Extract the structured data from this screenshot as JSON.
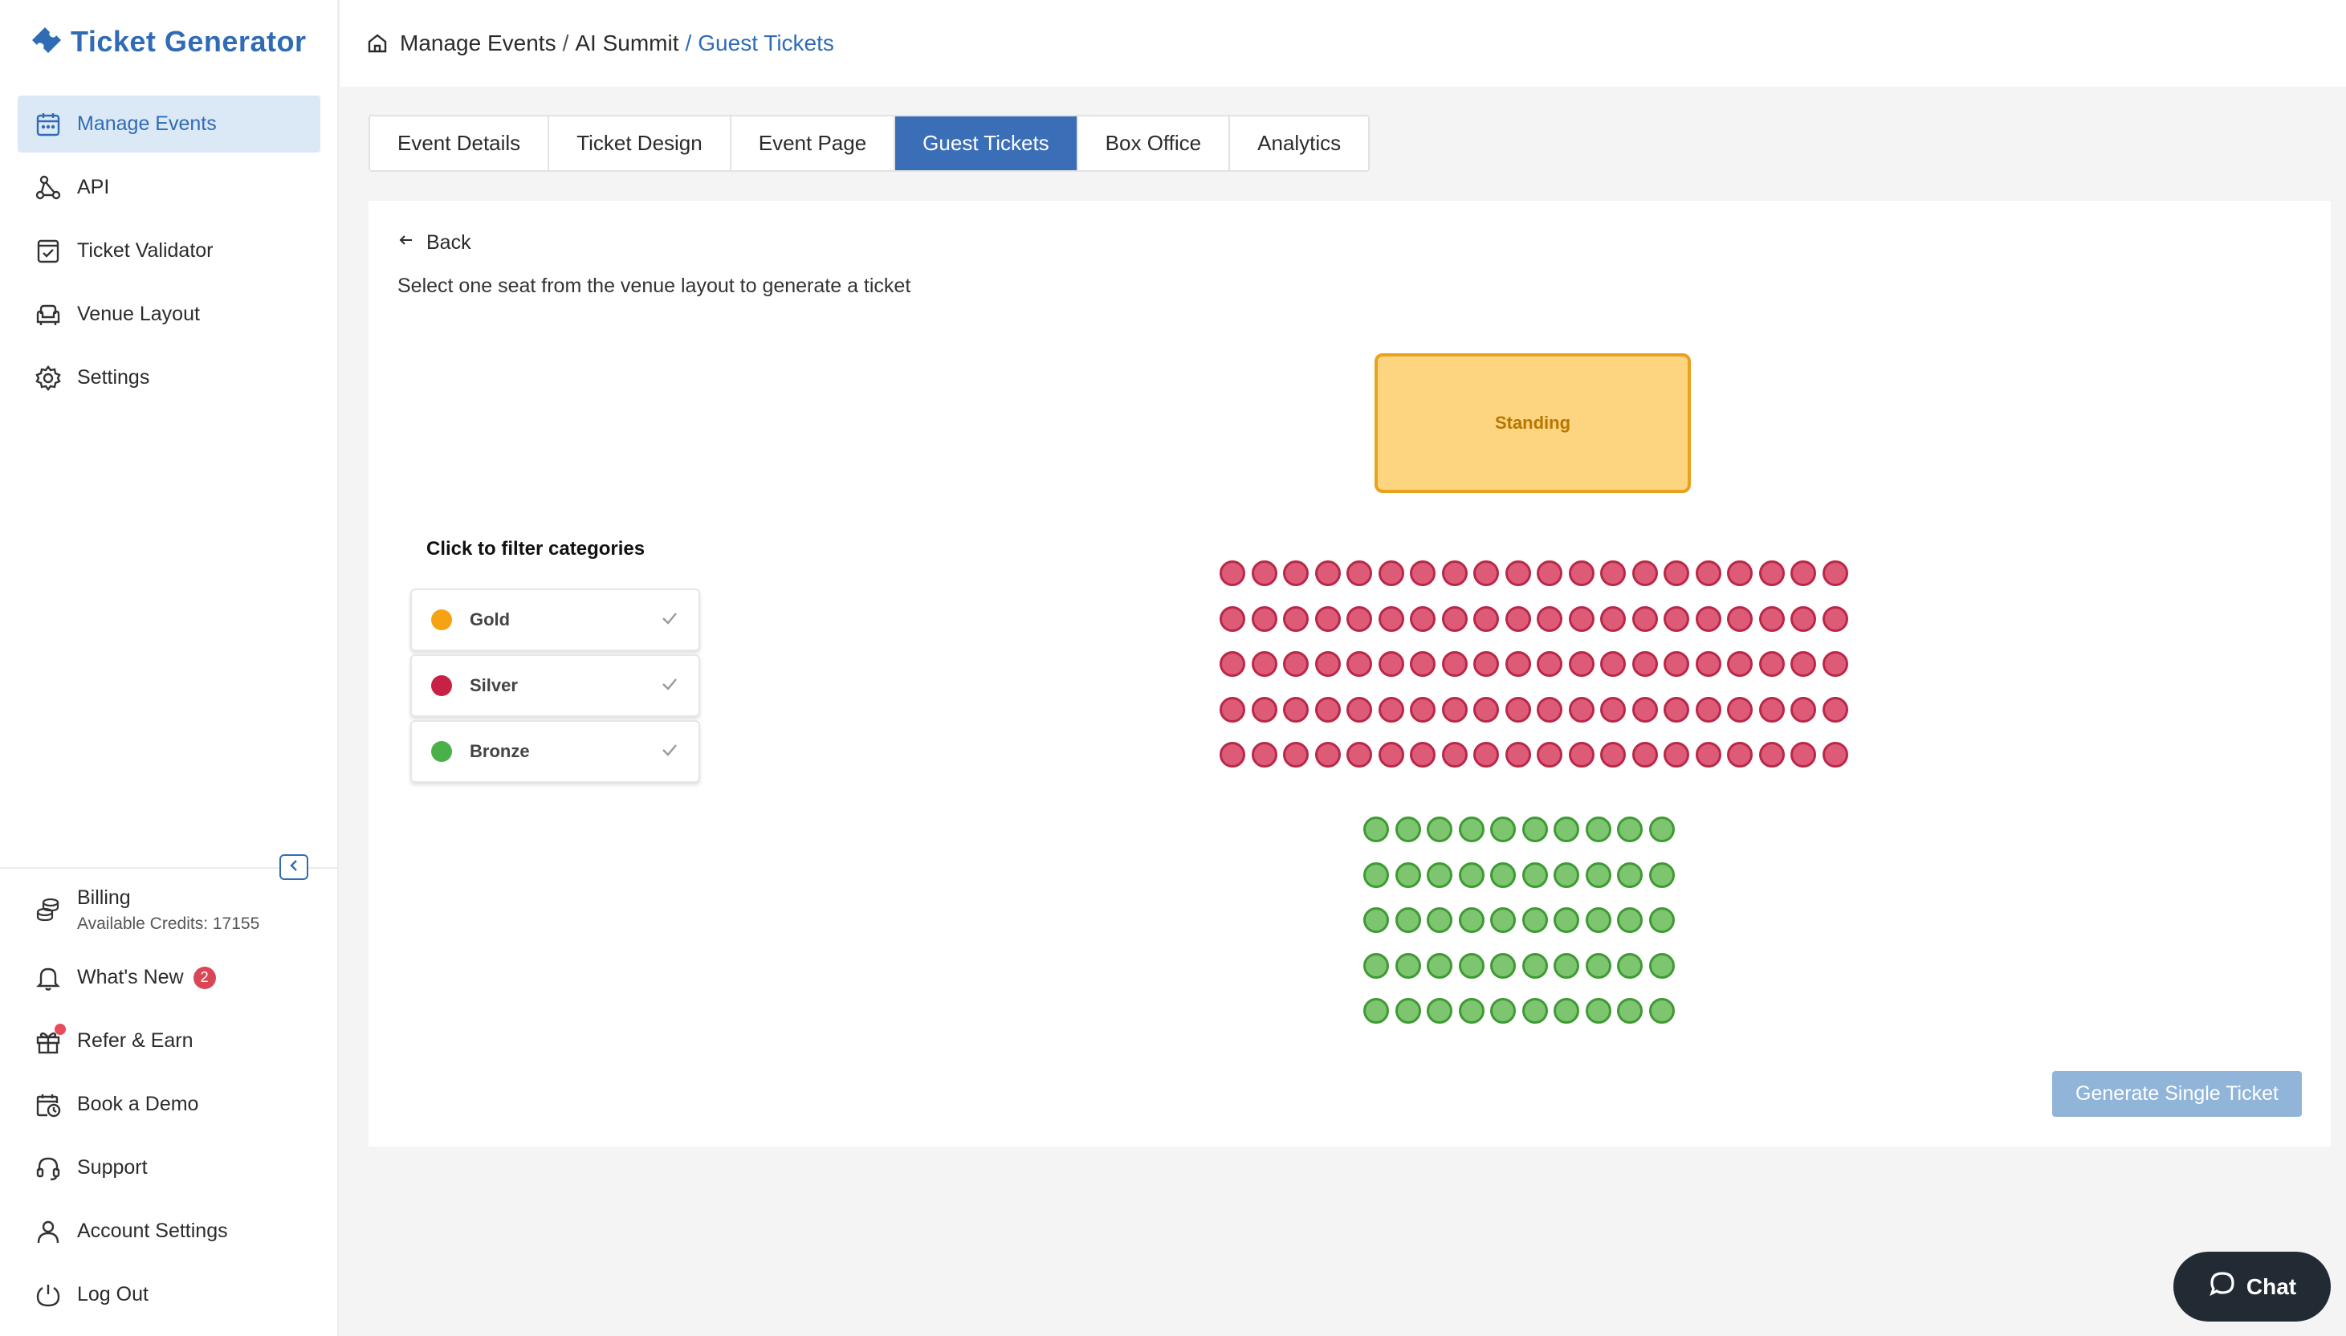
{
  "app": {
    "title": "Ticket Generator",
    "brand_color": "#2f6cb5"
  },
  "sidebar": {
    "items": [
      {
        "label": "Manage Events",
        "icon": "calendar-icon",
        "active": true
      },
      {
        "label": "API",
        "icon": "api-icon",
        "active": false
      },
      {
        "label": "Ticket Validator",
        "icon": "ticket-check-icon",
        "active": false
      },
      {
        "label": "Venue Layout",
        "icon": "armchair-icon",
        "active": false
      },
      {
        "label": "Settings",
        "icon": "gear-icon",
        "active": false
      }
    ],
    "bottom": {
      "billing_label": "Billing",
      "billing_sub": "Available Credits: 17155",
      "whats_new_label": "What's New",
      "whats_new_badge": "2",
      "refer_label": "Refer & Earn",
      "demo_label": "Book a Demo",
      "support_label": "Support",
      "account_label": "Account Settings",
      "logout_label": "Log Out"
    }
  },
  "breadcrumb": {
    "items": [
      "Manage Events",
      "AI Summit",
      "Guest Tickets"
    ],
    "separator": "/"
  },
  "tabs": [
    {
      "label": "Event Details",
      "active": false
    },
    {
      "label": "Ticket Design",
      "active": false
    },
    {
      "label": "Event Page",
      "active": false
    },
    {
      "label": "Guest Tickets",
      "active": true
    },
    {
      "label": "Box Office",
      "active": false
    },
    {
      "label": "Analytics",
      "active": false
    }
  ],
  "main": {
    "back_label": "Back",
    "instruction": "Select one seat from the venue layout to generate a ticket",
    "standing_label": "Standing",
    "filter_title": "Click to filter categories",
    "categories": [
      {
        "label": "Gold",
        "color": "#f5a215",
        "checked": true
      },
      {
        "label": "Silver",
        "color": "#c92145",
        "checked": true
      },
      {
        "label": "Bronze",
        "color": "#4bb04a",
        "checked": true
      }
    ],
    "seating": {
      "silver_rows": 5,
      "silver_cols": 20,
      "bronze_rows": 5,
      "bronze_cols": 10
    },
    "generate_label": "Generate Single Ticket"
  },
  "chat": {
    "label": "Chat"
  }
}
